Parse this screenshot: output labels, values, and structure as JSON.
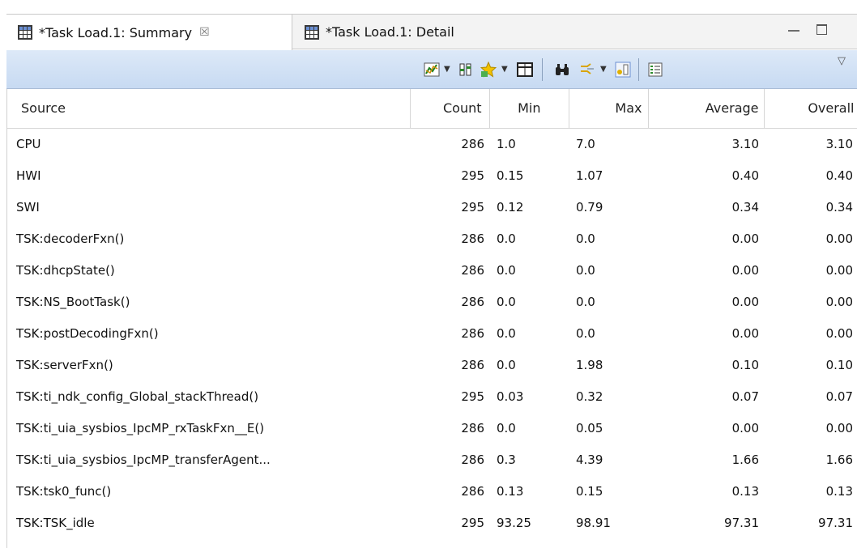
{
  "tabs": [
    {
      "label": "*Task Load.1: Summary",
      "active": true
    },
    {
      "label": "*Task Load.1: Detail",
      "active": false
    }
  ],
  "toolbar": {
    "icons": [
      "chart-icon",
      "columns-icon",
      "star-icon",
      "table-icon",
      "binoculars-icon",
      "filter-icon",
      "group-icon",
      "list-icon",
      "view-menu-icon"
    ],
    "background": "#c7daf2"
  },
  "table": {
    "headers": [
      "Source",
      "Count",
      "Min",
      "Max",
      "Average",
      "Overall"
    ],
    "rows": [
      {
        "source": "CPU",
        "count": "286",
        "min": "1.0",
        "max": "7.0",
        "avg": "3.10",
        "overall": "3.10"
      },
      {
        "source": "HWI",
        "count": "295",
        "min": "0.15",
        "max": "1.07",
        "avg": "0.40",
        "overall": "0.40"
      },
      {
        "source": "SWI",
        "count": "295",
        "min": "0.12",
        "max": "0.79",
        "avg": "0.34",
        "overall": "0.34"
      },
      {
        "source": "TSK:decoderFxn()",
        "count": "286",
        "min": "0.0",
        "max": "0.0",
        "avg": "0.00",
        "overall": "0.00"
      },
      {
        "source": "TSK:dhcpState()",
        "count": "286",
        "min": "0.0",
        "max": "0.0",
        "avg": "0.00",
        "overall": "0.00"
      },
      {
        "source": "TSK:NS_BootTask()",
        "count": "286",
        "min": "0.0",
        "max": "0.0",
        "avg": "0.00",
        "overall": "0.00"
      },
      {
        "source": "TSK:postDecodingFxn()",
        "count": "286",
        "min": "0.0",
        "max": "0.0",
        "avg": "0.00",
        "overall": "0.00"
      },
      {
        "source": "TSK:serverFxn()",
        "count": "286",
        "min": "0.0",
        "max": "1.98",
        "avg": "0.10",
        "overall": "0.10"
      },
      {
        "source": "TSK:ti_ndk_config_Global_stackThread()",
        "count": "295",
        "min": "0.03",
        "max": "0.32",
        "avg": "0.07",
        "overall": "0.07"
      },
      {
        "source": "TSK:ti_uia_sysbios_IpcMP_rxTaskFxn__E()",
        "count": "286",
        "min": "0.0",
        "max": "0.05",
        "avg": "0.00",
        "overall": "0.00"
      },
      {
        "source": "TSK:ti_uia_sysbios_IpcMP_transferAgent...",
        "count": "286",
        "min": "0.3",
        "max": "4.39",
        "avg": "1.66",
        "overall": "1.66"
      },
      {
        "source": "TSK:tsk0_func()",
        "count": "286",
        "min": "0.13",
        "max": "0.15",
        "avg": "0.13",
        "overall": "0.13"
      },
      {
        "source": "TSK:TSK_idle",
        "count": "295",
        "min": "93.25",
        "max": "98.91",
        "avg": "97.31",
        "overall": "97.31"
      }
    ]
  }
}
